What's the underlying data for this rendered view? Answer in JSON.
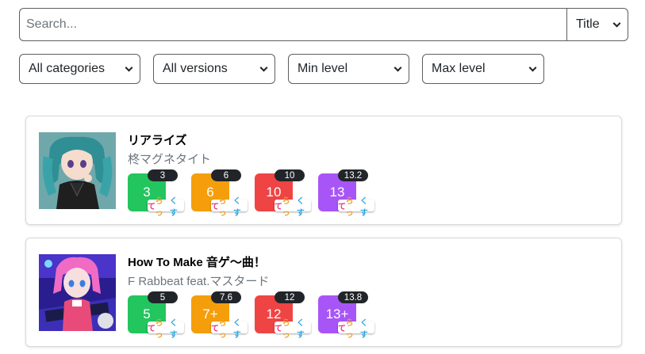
{
  "search": {
    "placeholder": "Search...",
    "value": "",
    "mode": "Title"
  },
  "filters": {
    "category": "All categories",
    "version": "All versions",
    "min_level": "Min level",
    "max_level": "Max level"
  },
  "songs": [
    {
      "title": "リアライズ",
      "artist": "柊マグネタイト",
      "difficulties": [
        {
          "level": "3",
          "constant": "3",
          "color": "#22c55e",
          "badge": [
            "て",
            "らっ",
            "くす"
          ]
        },
        {
          "level": "6",
          "constant": "6",
          "color": "#f59e0b",
          "badge": [
            "て",
            "らっ",
            "くす"
          ]
        },
        {
          "level": "10",
          "constant": "10",
          "color": "#ef4444",
          "badge": [
            "て",
            "らっ",
            "くす"
          ]
        },
        {
          "level": "13",
          "constant": "13.2",
          "color": "#a855f7",
          "badge": [
            "て",
            "らっ",
            "くす"
          ]
        }
      ]
    },
    {
      "title": "How To Make 音ゲ〜曲！",
      "artist": "F Rabbeat feat.マスタード",
      "difficulties": [
        {
          "level": "5",
          "constant": "5",
          "color": "#22c55e",
          "badge": [
            "て",
            "らっ",
            "くす"
          ]
        },
        {
          "level": "7+",
          "constant": "7.6",
          "color": "#f59e0b",
          "badge": [
            "て",
            "らっ",
            "くす"
          ]
        },
        {
          "level": "12",
          "constant": "12",
          "color": "#ef4444",
          "badge": [
            "て",
            "らっ",
            "くす"
          ]
        },
        {
          "level": "13+",
          "constant": "13.8",
          "color": "#a855f7",
          "badge": [
            "て",
            "らっ",
            "くす"
          ]
        }
      ]
    }
  ]
}
